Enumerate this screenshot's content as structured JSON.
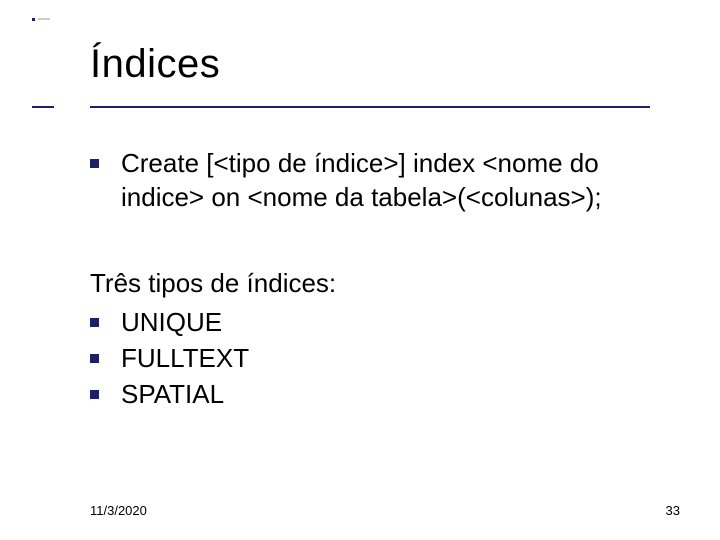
{
  "title": "Índices",
  "main_bullet": "Create [<tipo de índice>] index <nome do indice> on <nome da tabela>(<colunas>);",
  "sub_heading": "Três tipos de índices:",
  "items": [
    "UNIQUE",
    "FULLTEXT",
    "SPATIAL"
  ],
  "footer": {
    "date": "11/3/2020",
    "slide_number": "33"
  }
}
